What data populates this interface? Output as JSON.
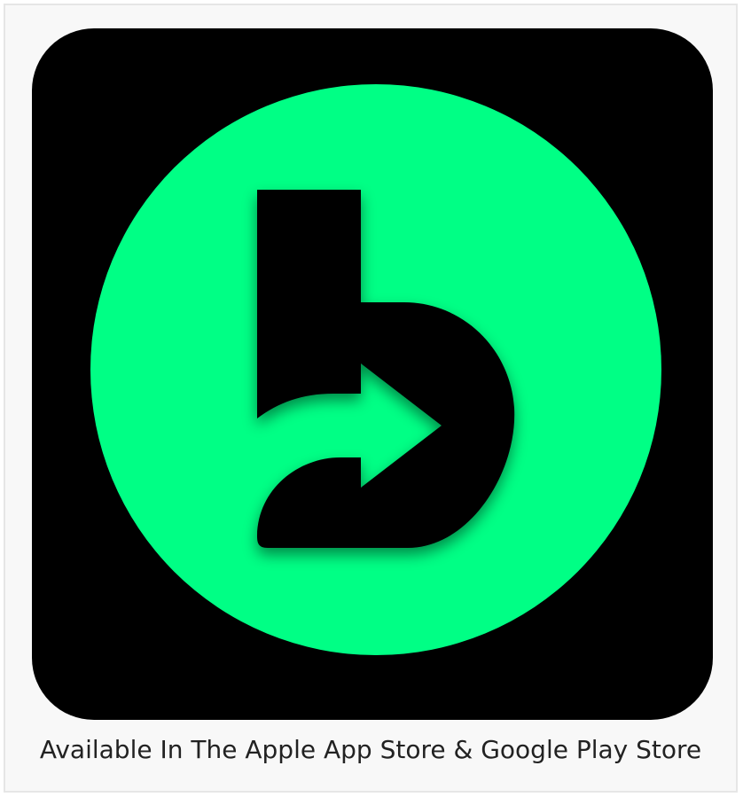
{
  "caption": {
    "text": "Available In The Apple App Store & Google Play Store"
  },
  "icon": {
    "name": "app-logo-icon",
    "background_color": "#000000",
    "circle_color": "#00FF85",
    "glyph_color": "#000000"
  }
}
